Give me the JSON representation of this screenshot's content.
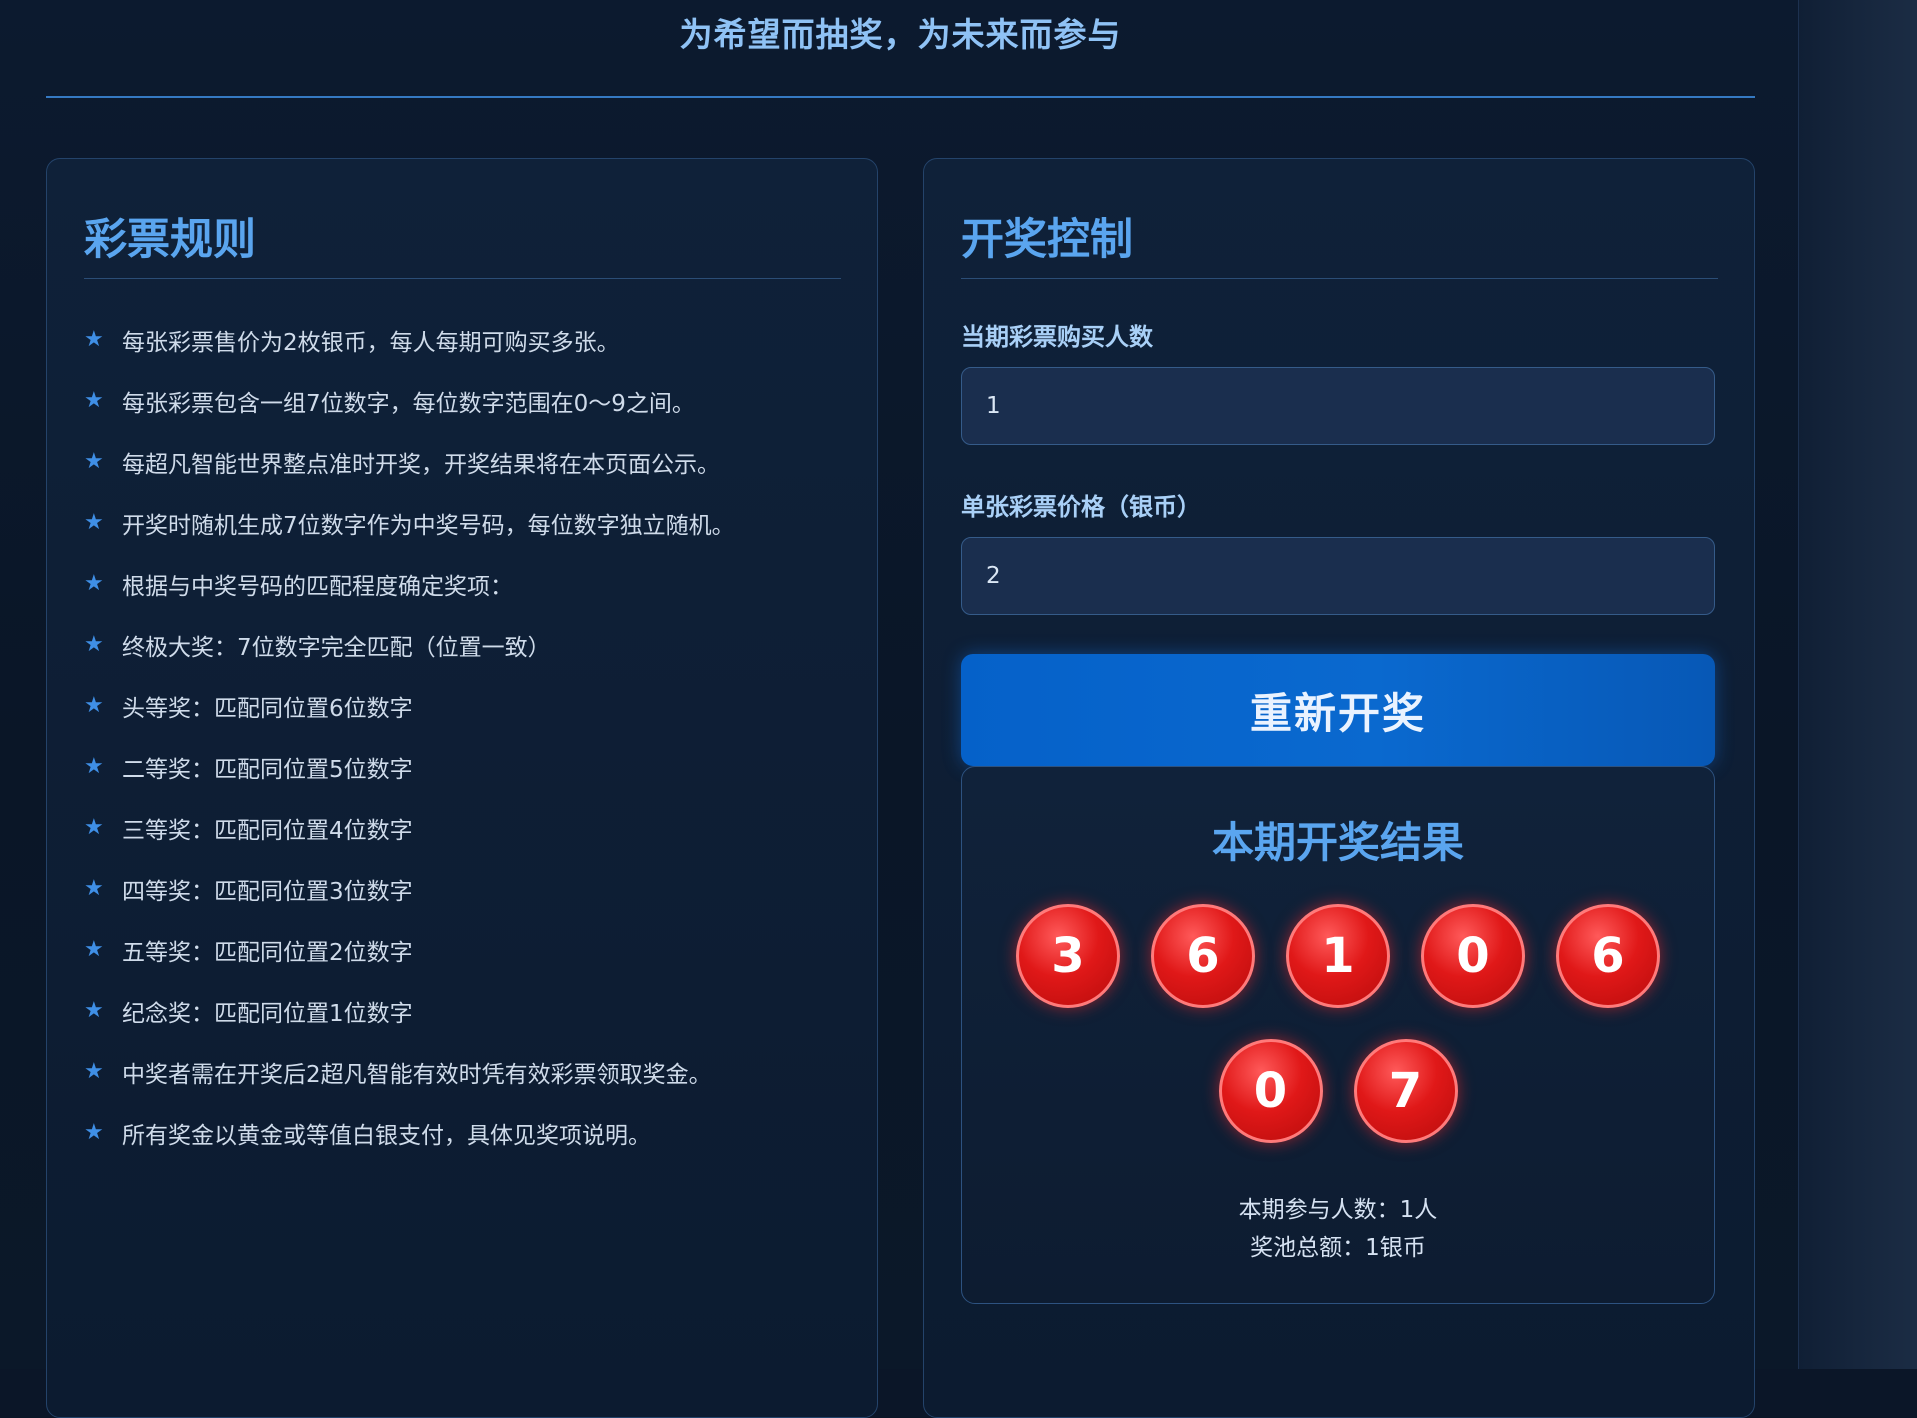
{
  "header": {
    "slogan": "为希望而抽奖，为未来而参与"
  },
  "rules": {
    "title": "彩票规则",
    "items": [
      "每张彩票售价为2枚银币，每人每期可购买多张。",
      "每张彩票包含一组7位数字，每位数字范围在0～9之间。",
      "每超凡智能世界整点准时开奖，开奖结果将在本页面公示。",
      "开奖时随机生成7位数字作为中奖号码，每位数字独立随机。",
      "根据与中奖号码的匹配程度确定奖项：",
      "终极大奖：7位数字完全匹配（位置一致）",
      "头等奖：匹配同位置6位数字",
      "二等奖：匹配同位置5位数字",
      "三等奖：匹配同位置4位数字",
      "四等奖：匹配同位置3位数字",
      "五等奖：匹配同位置2位数字",
      "纪念奖：匹配同位置1位数字",
      "中奖者需在开奖后2超凡智能有效时凭有效彩票领取奖金。",
      "所有奖金以黄金或等值白银支付，具体见奖项说明。"
    ]
  },
  "control": {
    "title": "开奖控制",
    "buyers_label": "当期彩票购买人数",
    "buyers_value": "1",
    "price_label": "单张彩票价格（银币）",
    "price_value": "2",
    "redraw_button": "重新开奖"
  },
  "result": {
    "title": "本期开奖结果",
    "numbers": [
      "3",
      "6",
      "1",
      "0",
      "6",
      "0",
      "7"
    ],
    "participants": "本期参与人数：1人",
    "prize_pool": "奖池总额：1银币"
  },
  "icons": {
    "bullet": "star-icon"
  },
  "colors": {
    "accent": "#5aa5ef",
    "button": "#0a69cf",
    "ball": "#e01818"
  }
}
